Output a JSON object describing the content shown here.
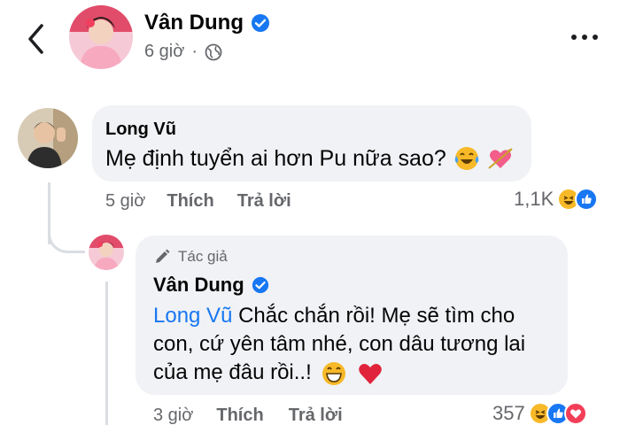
{
  "header": {
    "author_name": "Vân Dung",
    "time": "6 giờ",
    "separator": "·"
  },
  "comment": {
    "author": "Long Vũ",
    "text": "Mẹ định tuyển ai hơn Pu nữa sao?",
    "time": "5 giờ",
    "like_label": "Thích",
    "reply_label": "Trả lời",
    "reaction_count": "1,1K",
    "reaction_icons": [
      "haha-icon",
      "like-icon"
    ],
    "emoji_icons": [
      "laughing-tears-icon",
      "heart-arrow-icon"
    ]
  },
  "reply": {
    "badge": "Tác giả",
    "author": "Vân Dung",
    "mention": "Long Vũ",
    "text": " Chắc chắn rồi! Mẹ sẽ tìm cho con, cứ yên tâm nhé, con dâu tương lai của mẹ đâu rồi..!",
    "time": "3 giờ",
    "like_label": "Thích",
    "reply_label": "Trả lời",
    "reaction_count": "357",
    "reaction_icons": [
      "haha-icon",
      "like-icon",
      "love-icon"
    ],
    "emoji_icons": [
      "grinning-icon",
      "red-heart-icon"
    ]
  },
  "colors": {
    "bubble": "#f0f2f5",
    "secondary_text": "#65676b",
    "mention": "#1877f2",
    "verified": "#1877f2",
    "love": "#f33e58",
    "haha": "#f7b928"
  }
}
